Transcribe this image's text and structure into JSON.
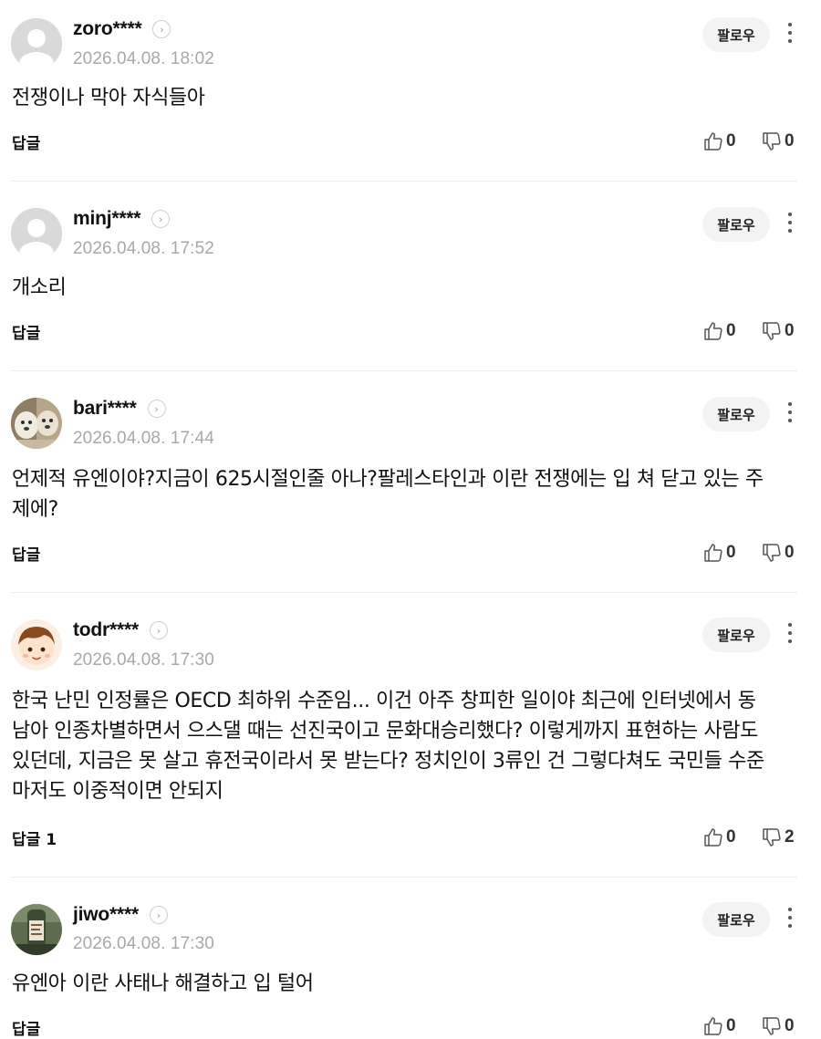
{
  "follow_label": "팔로우",
  "comments": [
    {
      "user": "zoro****",
      "date": "2026.04.08. 18:02",
      "text": "전쟁이나 막아 자식들아",
      "reply_label": "답글",
      "reply_count": "",
      "likes": "0",
      "dislikes": "0",
      "avatar": "default"
    },
    {
      "user": "minj****",
      "date": "2026.04.08. 17:52",
      "text": "개소리",
      "reply_label": "답글",
      "reply_count": "",
      "likes": "0",
      "dislikes": "0",
      "avatar": "default"
    },
    {
      "user": "bari****",
      "date": "2026.04.08. 17:44",
      "text": "언제적 유엔이야?지금이 625시절인줄 아나?팔레스타인과 이란 전쟁에는 입 쳐 닫고 있는 주제에?",
      "reply_label": "답글",
      "reply_count": "",
      "likes": "0",
      "dislikes": "0",
      "avatar": "dog-photo"
    },
    {
      "user": "todr****",
      "date": "2026.04.08. 17:30",
      "text": "한국 난민 인정률은 OECD 최하위 수준임... 이건 아주 창피한 일이야 최근에 인터넷에서 동남아 인종차별하면서 으스댈 때는 선진국이고 문화대승리했다? 이렇게까지 표현하는 사람도 있던데, 지금은 못 살고 휴전국이라서 못 받는다? 정치인이 3류인 건 그렇다쳐도 국민들 수준마저도 이중적이면 안되지",
      "reply_label": "답글",
      "reply_count": "1",
      "likes": "0",
      "dislikes": "2",
      "avatar": "cartoon-face"
    },
    {
      "user": "jiwo****",
      "date": "2026.04.08. 17:30",
      "text": "유엔아 이란 사태나 해결하고 입 털어",
      "reply_label": "답글",
      "reply_count": "",
      "likes": "0",
      "dislikes": "0",
      "avatar": "bottle-photo"
    }
  ]
}
